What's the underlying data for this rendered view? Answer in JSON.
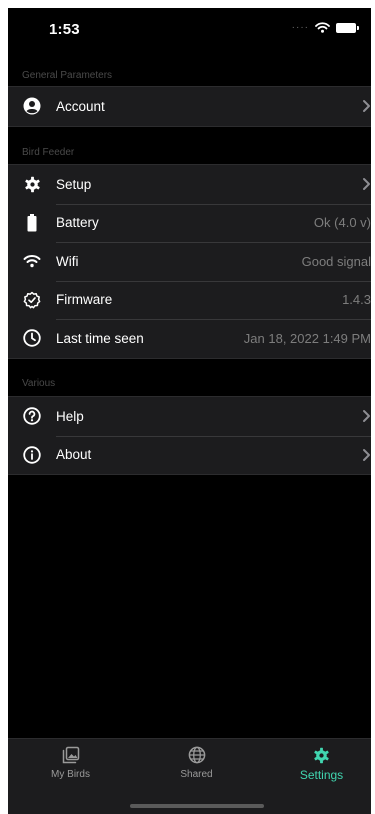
{
  "status_bar": {
    "time": "1:53",
    "signal": "····"
  },
  "sections": {
    "general": {
      "header": "General Parameters",
      "account": {
        "label": "Account"
      }
    },
    "bird_feeder": {
      "header": "Bird Feeder",
      "setup": {
        "label": "Setup"
      },
      "battery": {
        "label": "Battery",
        "value": "Ok (4.0 v)"
      },
      "wifi": {
        "label": "Wifi",
        "value": "Good signal"
      },
      "firmware": {
        "label": "Firmware",
        "value": "1.4.3"
      },
      "last_seen": {
        "label": "Last time seen",
        "value": "Jan 18, 2022 1:49 PM"
      }
    },
    "various": {
      "header": "Various",
      "help": {
        "label": "Help"
      },
      "about": {
        "label": "About"
      }
    }
  },
  "tab_bar": {
    "tabs": [
      {
        "label": "My Birds",
        "icon": "photo-icon"
      },
      {
        "label": "Shared",
        "icon": "globe-icon"
      },
      {
        "label": "Settings",
        "icon": "gear-icon"
      }
    ],
    "active_index": 2
  },
  "colors": {
    "background": "#000000",
    "cell": "#1c1c1e",
    "accent": "#41d6b0",
    "secondary_text": "#7d7d7d"
  }
}
